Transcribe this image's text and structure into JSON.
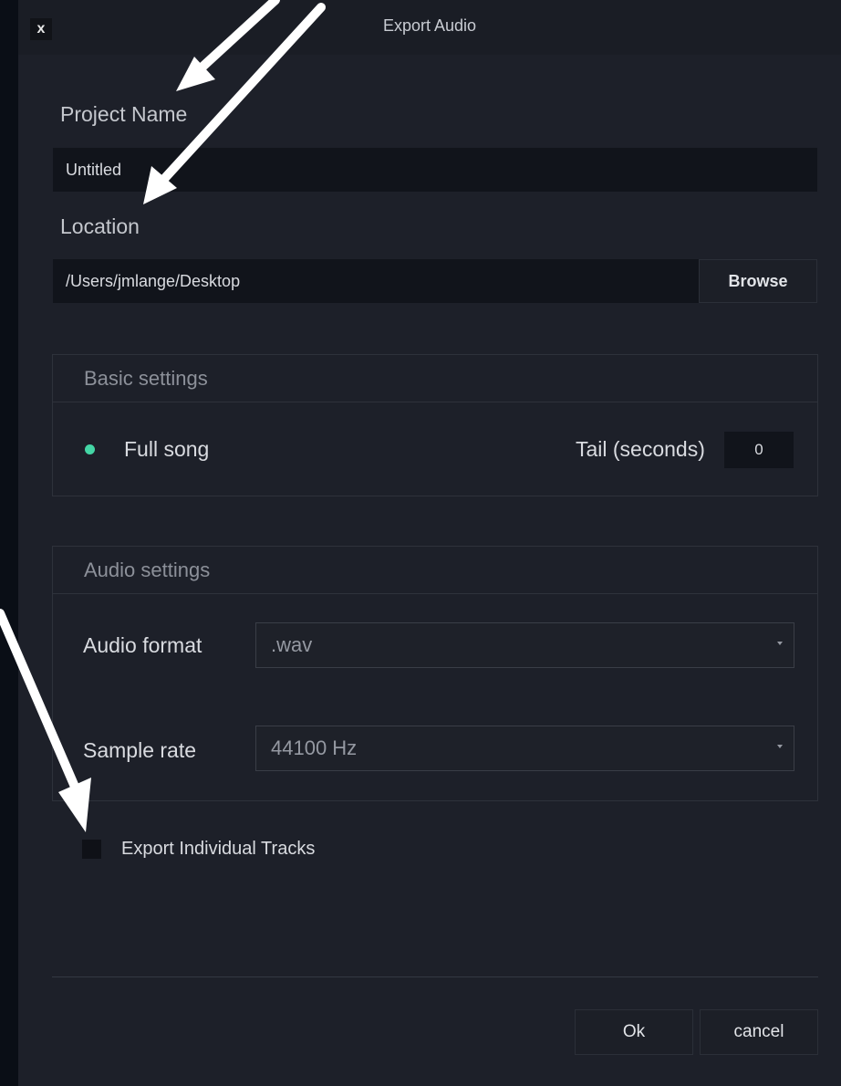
{
  "dialog": {
    "title": "Export Audio",
    "close_label": "x"
  },
  "project_name": {
    "label": "Project Name",
    "value": "Untitled"
  },
  "location": {
    "label": "Location",
    "value": "/Users/jmlange/Desktop",
    "browse_label": "Browse"
  },
  "basic_settings": {
    "header": "Basic settings",
    "full_song_label": "Full song",
    "tail_label": "Tail (seconds)",
    "tail_value": "0",
    "accent_color": "#44d6a5"
  },
  "audio_settings": {
    "header": "Audio settings",
    "format_label": "Audio format",
    "format_value": ".wav",
    "sample_rate_label": "Sample rate",
    "sample_rate_value": "44100 Hz"
  },
  "export_individual": {
    "label": "Export Individual Tracks",
    "checked": false
  },
  "footer": {
    "ok_label": "Ok",
    "cancel_label": "cancel"
  },
  "annotations": {
    "arrow_color": "#ffffff",
    "arrow_icon": "white-arrow"
  }
}
